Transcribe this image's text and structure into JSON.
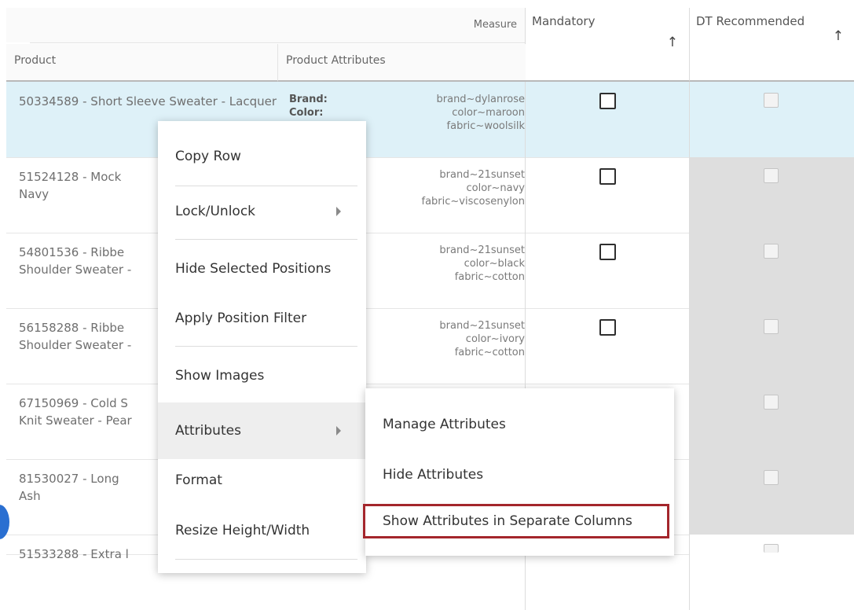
{
  "header": {
    "measure_label": "Measure",
    "product_label": "Product",
    "product_attributes_label": "Product Attributes",
    "mandatory_label": "Mandatory",
    "dt_recommended_label": "DT Recommended",
    "sort_arrow": "↑"
  },
  "rows": [
    {
      "product": "50334589 - Short Sleeve Sweater - Lacquer",
      "attr_keys": "Brand:\nColor:",
      "attr_vals": "brand~dylanrose\ncolor~maroon\nfabric~woolsilk",
      "selected": true
    },
    {
      "product": "51524128 - Mock\nNavy",
      "attr_keys": "",
      "attr_vals": "brand~21sunset\ncolor~navy\nfabric~viscosenylon",
      "selected": false
    },
    {
      "product": "54801536 - Ribbe\nShoulder Sweater -",
      "attr_keys": "",
      "attr_vals": "brand~21sunset\ncolor~black\nfabric~cotton",
      "selected": false
    },
    {
      "product": "56158288 - Ribbe\nShoulder Sweater -",
      "attr_keys": "",
      "attr_vals": "brand~21sunset\ncolor~ivory\nfabric~cotton",
      "selected": false
    },
    {
      "product": "67150969 - Cold S\nKnit Sweater - Pear",
      "attr_keys": "",
      "attr_vals": "",
      "selected": false
    },
    {
      "product": "81530027 - Long\nAsh",
      "attr_keys": "",
      "attr_vals": "",
      "selected": false
    },
    {
      "product": "51533288 - Extra l",
      "attr_keys": "",
      "attr_vals": "",
      "selected": false
    }
  ],
  "context_menu": {
    "items": [
      {
        "label": "Copy Row",
        "has_submenu": false
      },
      {
        "label": "Lock/Unlock",
        "has_submenu": true
      },
      {
        "label": "Hide Selected Positions",
        "has_submenu": false
      },
      {
        "label": "Apply Position Filter",
        "has_submenu": false
      },
      {
        "label": "Show Images",
        "has_submenu": false
      },
      {
        "label": "Attributes",
        "has_submenu": true
      },
      {
        "label": "Format",
        "has_submenu": false
      },
      {
        "label": "Resize Height/Width",
        "has_submenu": false
      }
    ]
  },
  "submenu": {
    "items": [
      {
        "label": "Manage Attributes"
      },
      {
        "label": "Hide Attributes"
      },
      {
        "label": "Show Attributes in Separate Columns"
      }
    ],
    "highlight_color": "#a4262c"
  },
  "colors": {
    "selected_row": "#def1f8",
    "disabled_cell": "#dedede"
  }
}
